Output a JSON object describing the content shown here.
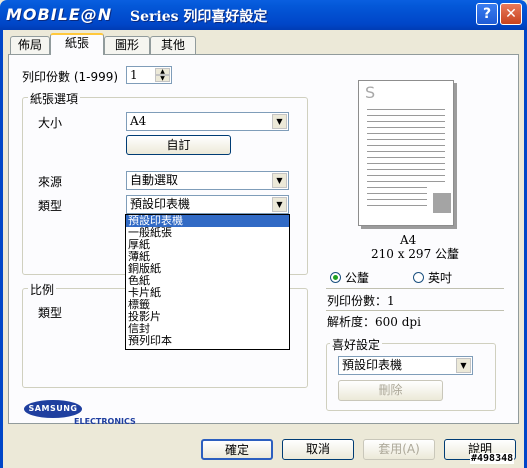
{
  "window": {
    "logo_text": "MOBILE@N",
    "title": "Series 列印喜好設定",
    "help_label": "?",
    "close_label": "✕"
  },
  "tabs": [
    "佈局",
    "紙張",
    "圖形",
    "其他"
  ],
  "copies": {
    "label": "列印份數 (1-999)",
    "value": "1"
  },
  "paper_options": {
    "group_label": "紙張選項",
    "size_label": "大小",
    "size_value": "A4",
    "custom_button": "自訂",
    "source_label": "來源",
    "source_value": "自動選取",
    "type_label": "類型",
    "type_value": "預設印表機",
    "type_options": [
      "預設印表機",
      "一般紙張",
      "厚紙",
      "薄紙",
      "銅版紙",
      "色紙",
      "卡片紙",
      "標籤",
      "投影片",
      "信封",
      "預列印本"
    ]
  },
  "scale": {
    "group_label": "比例",
    "type_label": "類型"
  },
  "preview": {
    "page_letter": "S",
    "paper_name": "A4",
    "paper_dims": "210 x 297 公釐",
    "unit_mm": "公釐",
    "unit_inch": "英吋",
    "copies_info": "列印份數：1",
    "resolution_info": "解析度：600 dpi"
  },
  "favorites": {
    "group_label": "喜好設定",
    "value": "預設印表機",
    "delete_button": "刪除"
  },
  "brand": {
    "name": "SAMSUNG",
    "sub": "ELECTRONICS"
  },
  "footer": {
    "ok": "確定",
    "cancel": "取消",
    "apply": "套用(A)",
    "help": "說明"
  },
  "watermark": "#498348"
}
